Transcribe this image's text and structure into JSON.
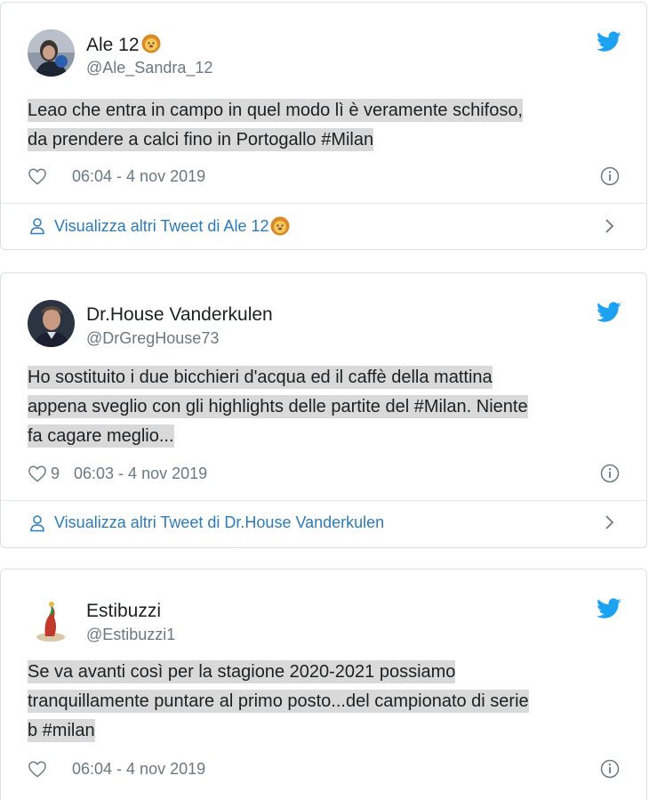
{
  "tweets": [
    {
      "name": "Ale 12",
      "name_emoji": "lion-face",
      "handle": "@Ale_Sandra_12",
      "text_lines": [
        "Leao che entra in campo in quel modo lì è veramente schifoso,",
        "da prendere a calci fino in Portogallo #Milan"
      ],
      "likes": "",
      "timestamp": "06:04 - 4 nov 2019",
      "more_link": "Visualizza altri Tweet di Ale 12",
      "more_link_emoji": "lion-face"
    },
    {
      "name": "Dr.House Vanderkulen",
      "handle": "@DrGregHouse73",
      "text_lines": [
        "Ho sostituito i due bicchieri d'acqua ed il caffè della mattina",
        "appena sveglio con gli highlights delle partite del #Milan. Niente",
        "fa cagare meglio..."
      ],
      "likes": "9",
      "timestamp": "06:03 - 4 nov 2019",
      "more_link": "Visualizza altri Tweet di Dr.House Vanderkulen"
    },
    {
      "name": "Estibuzzi",
      "handle": "@Estibuzzi1",
      "text_lines": [
        "Se va avanti così per la stagione 2020-2021 possiamo",
        "tranquillamente puntare al primo posto...del campionato di serie",
        "b #milan"
      ],
      "likes": "",
      "timestamp": "06:04 - 4 nov 2019"
    }
  ],
  "colors": {
    "twitter_blue": "#1da1f2",
    "link_blue": "#2b7bb9",
    "meta_gray": "#697882",
    "highlight": "#d9d9d9",
    "border": "#d8e0e6"
  },
  "icons": [
    "twitter-bird-icon",
    "heart-icon",
    "info-icon",
    "person-icon",
    "chevron-right-icon",
    "lion-face-emoji"
  ]
}
